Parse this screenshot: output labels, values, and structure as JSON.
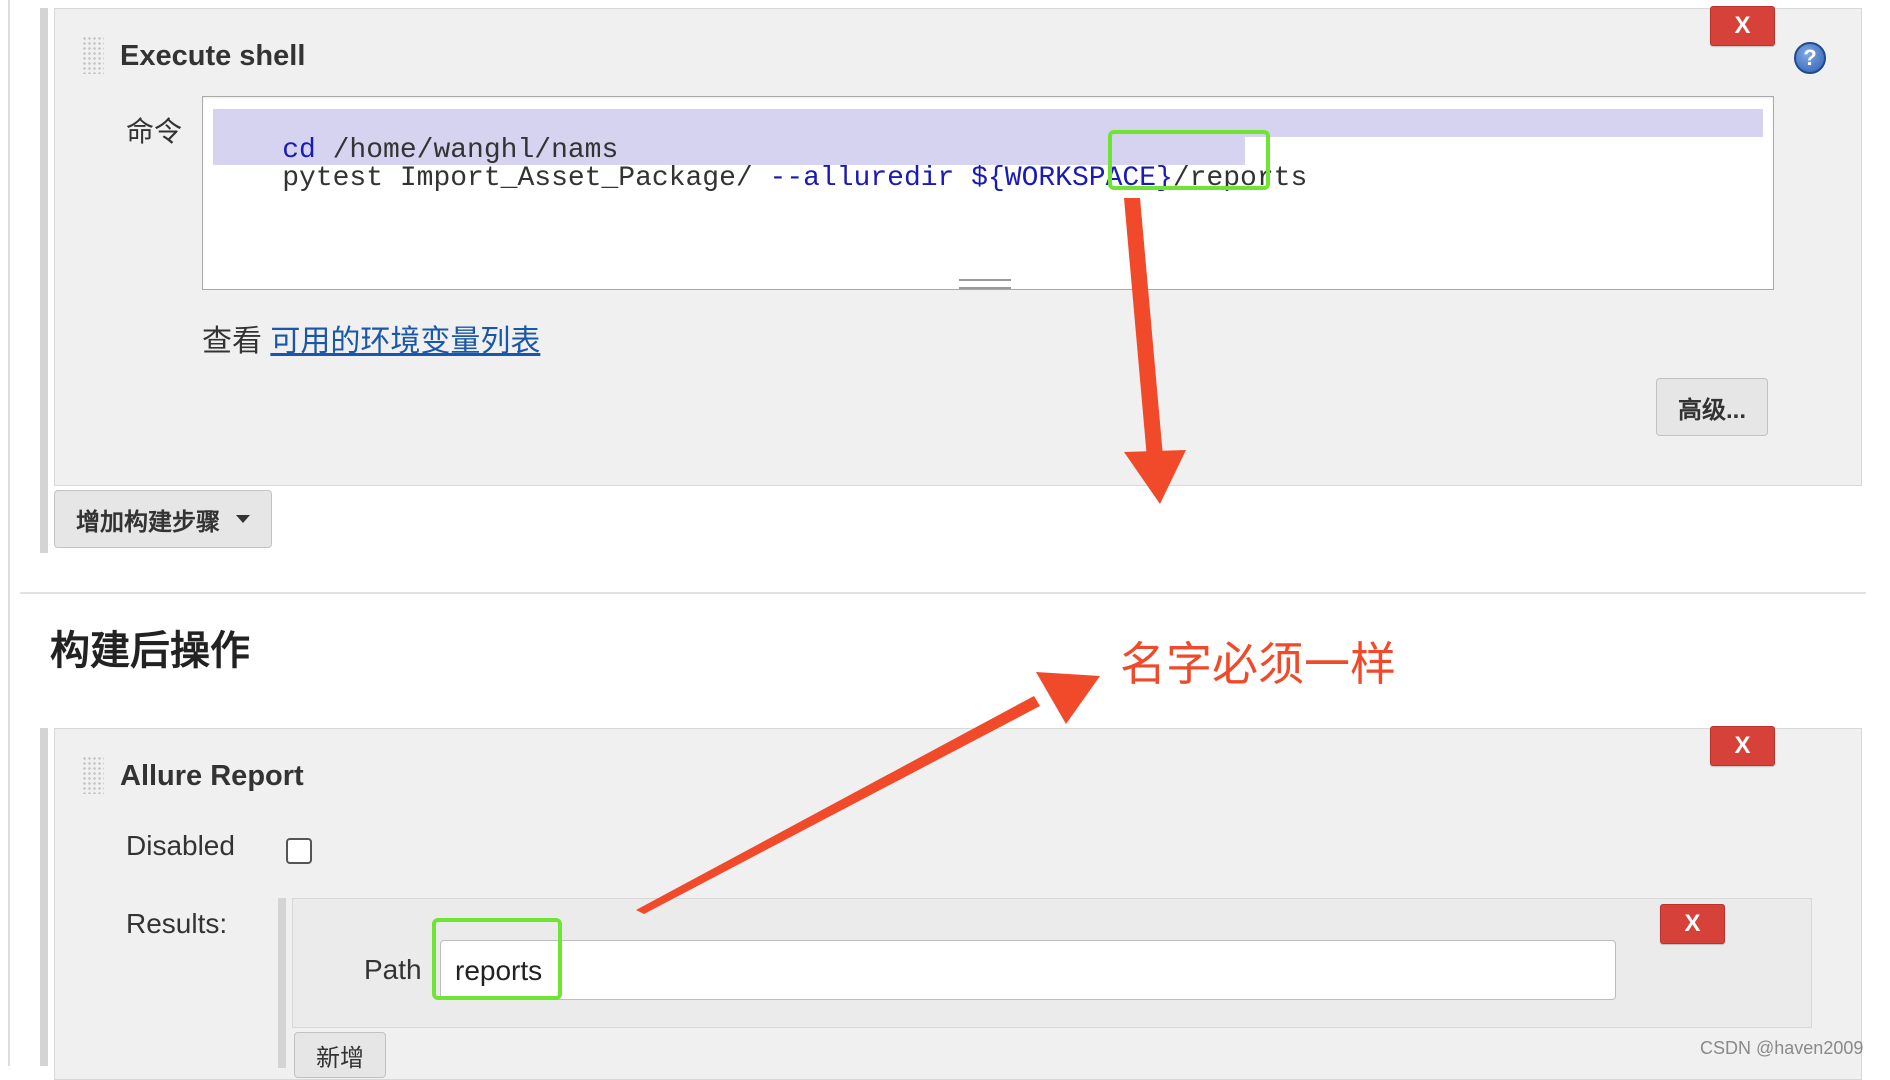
{
  "execute_shell": {
    "title": "Execute shell",
    "delete_label": "X",
    "help_glyph": "?",
    "command_label": "命令",
    "command_lines": [
      {
        "kw": "cd",
        "rest": " /home/wanghl/nams"
      },
      {
        "kw": "pytest",
        "pre": " Import_Asset_Package/ ",
        "opt": "--alluredir",
        "var": "${WORKSPACE}",
        "slash": "/",
        "tail": "reports"
      }
    ],
    "env_prefix": "查看",
    "env_link": "可用的环境变量列表",
    "advanced_button": "高级..."
  },
  "add_build_step": {
    "label": "增加构建步骤",
    "icon": "caret-down-icon"
  },
  "post_build": {
    "title": "构建后操作"
  },
  "annotation": {
    "text": "名字必须一样",
    "arrow_color": "#f04a2a",
    "highlight_color": "#6ee533"
  },
  "allure_report": {
    "title": "Allure Report",
    "delete_label": "X",
    "disabled_label": "Disabled",
    "disabled_checked": false,
    "results_label": "Results:",
    "path_label": "Path",
    "path_value": "reports",
    "result_delete_label": "X",
    "add_button": "新增"
  },
  "watermark": "CSDN @haven2009"
}
